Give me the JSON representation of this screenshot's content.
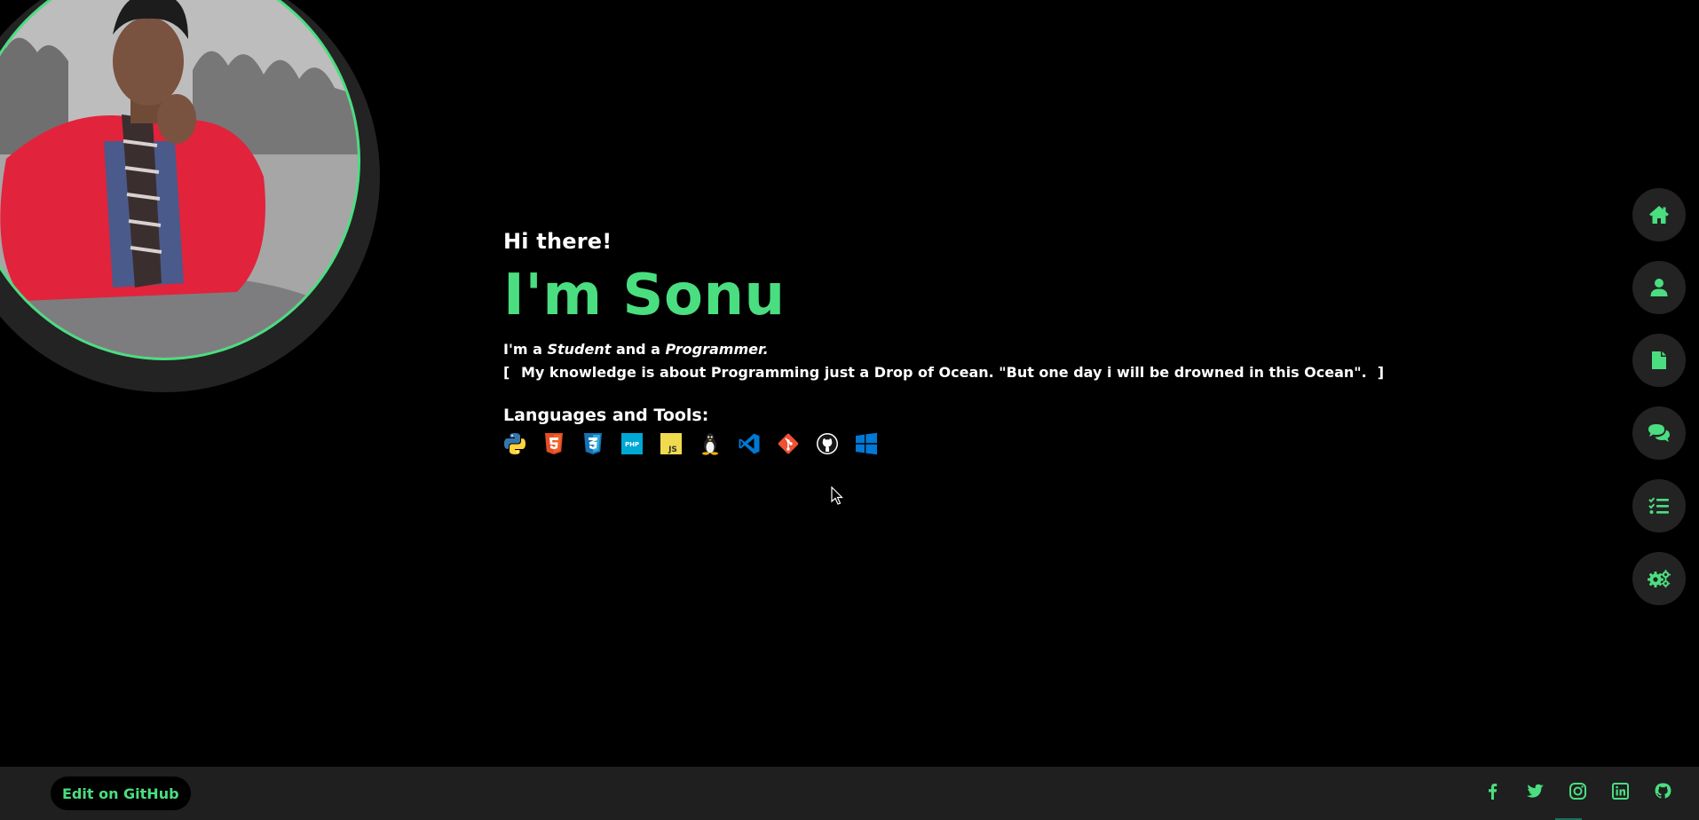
{
  "intro": {
    "greeting": "Hi there!",
    "name": "I'm Sonu",
    "role_prefix": "I'm a",
    "role_1": "Student",
    "role_mid": "and a",
    "role_2": "Programmer.",
    "bracket_open": "[",
    "quote": "My knowledge is about Programming just a Drop of Ocean. \"But one day i will be drowned in this Ocean\".",
    "bracket_close": "]",
    "tools_title": "Languages and Tools:"
  },
  "tools": [
    {
      "name": "python",
      "icon": "python-icon"
    },
    {
      "name": "html5",
      "icon": "html5-icon"
    },
    {
      "name": "css3",
      "icon": "css3-icon"
    },
    {
      "name": "php",
      "icon": "php-icon"
    },
    {
      "name": "javascript",
      "icon": "javascript-icon"
    },
    {
      "name": "linux",
      "icon": "linux-icon"
    },
    {
      "name": "vscode",
      "icon": "vscode-icon"
    },
    {
      "name": "git",
      "icon": "git-icon"
    },
    {
      "name": "github",
      "icon": "github-icon"
    },
    {
      "name": "windows",
      "icon": "windows-icon"
    }
  ],
  "sidenav": [
    "home-icon",
    "user-icon",
    "file-icon",
    "comments-icon",
    "tasks-icon",
    "settings-icon"
  ],
  "footer": {
    "edit_button": "Edit on GitHub",
    "socials": [
      "facebook-icon",
      "twitter-icon",
      "instagram-icon",
      "linkedin-icon",
      "github-icon"
    ]
  },
  "colors": {
    "accent": "#4ade80",
    "background": "#000000",
    "panel": "#232323"
  }
}
